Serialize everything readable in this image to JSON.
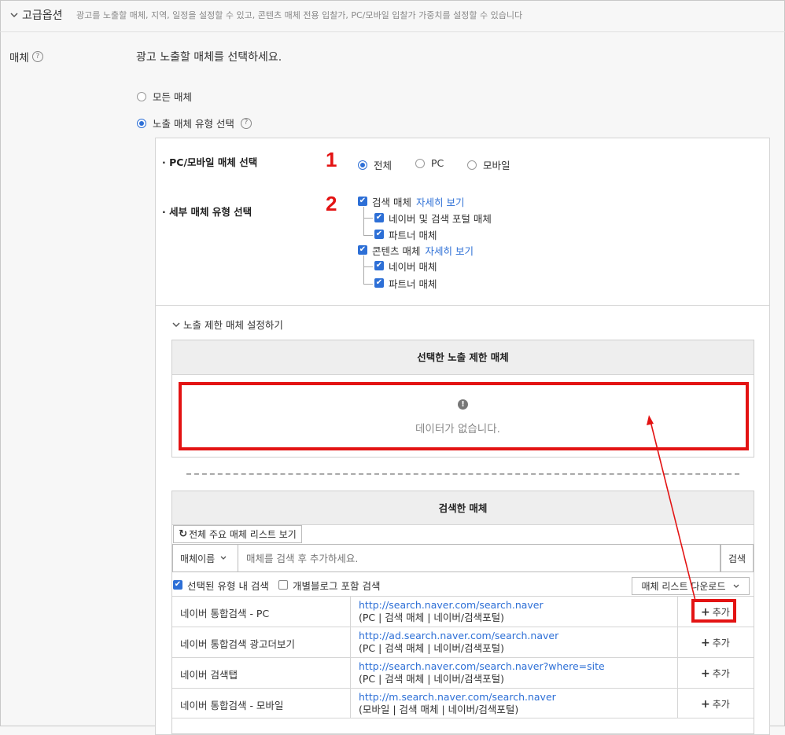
{
  "header": {
    "title": "고급옵션",
    "description": "광고를 노출할 매체, 지역, 일정을 설정할 수 있고, 콘텐츠 매체 전용 입찰가, PC/모바일 입찰가 가중치를 설정할 수 있습니다"
  },
  "media": {
    "label": "매체",
    "prompt": "광고 노출할 매체를 선택하세요.",
    "options": {
      "all": "모든 매체",
      "type": "노출 매체 유형 선택"
    }
  },
  "device": {
    "label": "PC/모바일 매체 선택",
    "step": "1",
    "options": [
      "전체",
      "PC",
      "모바일"
    ],
    "selected": "전체"
  },
  "detail": {
    "label": "세부 매체 유형 선택",
    "step": "2",
    "search_media": "검색 매체",
    "search_more": "자세히 보기",
    "search_children": [
      "네이버 및 검색 포털 매체",
      "파트너 매체"
    ],
    "content_media": "콘텐츠 매체",
    "content_more": "자세히 보기",
    "content_children": [
      "네이버 매체",
      "파트너 매체"
    ]
  },
  "restrict": {
    "toggle": "노출 제한 매체 설정하기",
    "selected_title": "선택한 노출 제한 매체",
    "empty": "데이터가 없습니다."
  },
  "searched": {
    "title": "검색한 매체",
    "list_button": "전체 주요 매체 리스트 보기",
    "select_value": "매체이름",
    "search_placeholder": "매체를 검색 후 추가하세요.",
    "search_button": "검색",
    "check_in_type": "선택된 유형 내 검색",
    "check_blog": "개별블로그 포함 검색",
    "download": "매체 리스트 다운로드",
    "add_label": "추가",
    "rows": [
      {
        "name": "네이버 통합검색 - PC",
        "url": "http://search.naver.com/search.naver",
        "meta": "(PC | 검색 매체 | 네이버/검색포털)"
      },
      {
        "name": "네이버 통합검색 광고더보기",
        "url": "http://ad.search.naver.com/search.naver",
        "meta": "(PC | 검색 매체 | 네이버/검색포털)"
      },
      {
        "name": "네이버 검색탭",
        "url": "http://search.naver.com/search.naver?where=site",
        "meta": "(PC | 검색 매체 | 네이버/검색포털)"
      },
      {
        "name": "네이버 통합검색 - 모바일",
        "url": "http://m.search.naver.com/search.naver",
        "meta": "(모바일 | 검색 매체 | 네이버/검색포털)"
      }
    ]
  },
  "colors": {
    "accent": "#2d6fd6",
    "highlight": "#e31313"
  }
}
